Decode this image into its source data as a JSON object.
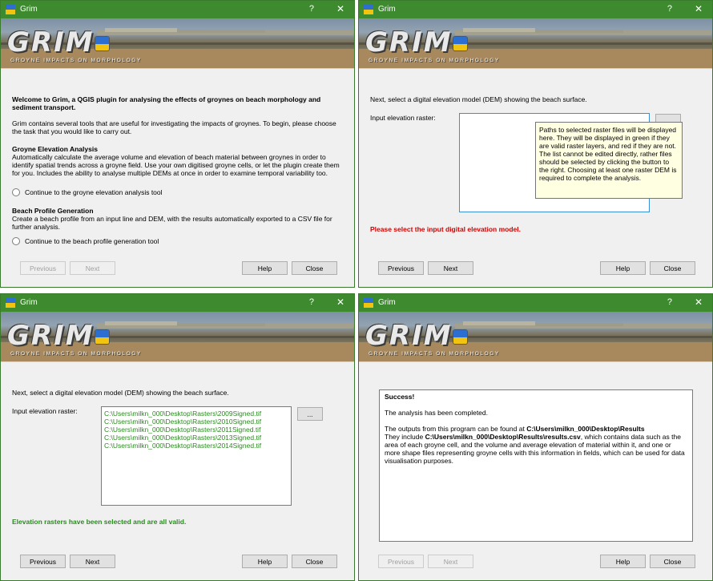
{
  "app": {
    "title": "Grim",
    "help_glyph": "?",
    "close_glyph": "✕",
    "logo_text": "GRIM",
    "logo_tagline": "GROYNE IMPACTS ON MORPHOLOGY"
  },
  "buttons": {
    "previous": "Previous",
    "next": "Next",
    "help": "Help",
    "close": "Close",
    "browse": "..."
  },
  "panel1": {
    "welcome": "Welcome to Grim, a QGIS plugin for analysing the effects of groynes on beach morphology and sediment transport.",
    "intro": "Grim contains several tools that are useful for investigating the impacts of groynes. To begin, please choose the task that you would like to carry out.",
    "section1_title": "Groyne Elevation Analysis",
    "section1_desc": "Automatically calculate the average volume and elevation of beach material between groynes in order to identify spatial trends across a groyne field. Use your own digitised groyne cells, or let the plugin create them for you. Includes the ability to analyse multiple DEMs at once in order to examine temporal variability too.",
    "option1": "Continue to the groyne elevation analysis tool",
    "section2_title": "Beach Profile Generation",
    "section2_desc": "Create a beach profile from an input line and DEM, with the results automatically exported to a CSV file for further analysis.",
    "option2": "Continue to the beach profile generation tool"
  },
  "panel2": {
    "instruction": "Next, select a digital elevation model (DEM) showing the beach surface.",
    "input_label": "Input elevation raster:",
    "tooltip": "Paths to selected raster files will be displayed here. They will be displayed in green if they are valid raster layers, and red if they are not. The list cannot be edited directly, rather files should be selected by clicking the button to the right. Choosing at least one raster DEM is required to complete the analysis.",
    "error": "Please select the input digital elevation model."
  },
  "panel3": {
    "instruction": "Next, select a digital elevation model (DEM) showing the beach surface.",
    "input_label": "Input elevation raster:",
    "rasters": [
      "C:\\Users\\milkn_000\\Desktop\\Rasters\\2009Signed.tif",
      "C:\\Users\\milkn_000\\Desktop\\Rasters\\2010Signed.tif",
      "C:\\Users\\milkn_000\\Desktop\\Rasters\\2011Signed.tif",
      "C:\\Users\\milkn_000\\Desktop\\Rasters\\2013Signed.tif",
      "C:\\Users\\milkn_000\\Desktop\\Rasters\\2014Signed.tif"
    ],
    "status": "Elevation rasters have been selected and are all valid."
  },
  "panel4": {
    "success": "Success!",
    "completed": "The analysis has been completed.",
    "found_prefix": "The outputs from this program can be found at ",
    "found_path": "C:\\Users\\milkn_000\\Desktop\\Results",
    "include_prefix": "They include ",
    "include_path": "C:\\Users\\milkn_000\\Desktop\\Results\\results.csv",
    "include_rest": ", which contains data such as the area of each groyne cell, and the volume and average elevation of material within it, and one or more shape files representing groyne cells with this information in fields, which can be used for data visualisation purposes."
  },
  "colors": {
    "titlebar": "#3e8a2f",
    "error_red": "#d40000",
    "valid_green": "#2a8a1f",
    "tooltip_bg": "#ffffe1"
  }
}
